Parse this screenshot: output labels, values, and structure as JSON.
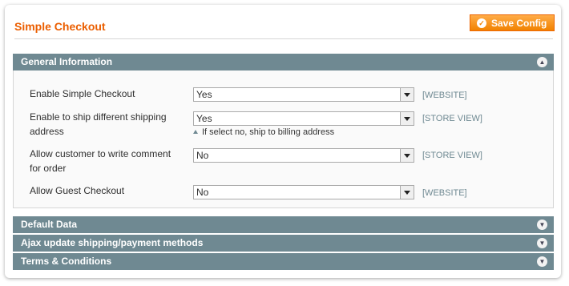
{
  "page": {
    "title": "Simple Checkout",
    "save_label": "Save Config"
  },
  "sections": [
    {
      "label": "General Information",
      "state": "expanded"
    },
    {
      "label": "Default Data",
      "state": "collapsed"
    },
    {
      "label": "Ajax update shipping/payment methods",
      "state": "collapsed"
    },
    {
      "label": "Terms & Conditions",
      "state": "collapsed"
    }
  ],
  "general": {
    "rows": [
      {
        "label": "Enable Simple Checkout",
        "value": "Yes",
        "scope": "[WEBSITE]"
      },
      {
        "label": "Enable to ship different shipping address",
        "value": "Yes",
        "scope": "[STORE VIEW]",
        "note": "If select no, ship to billing address"
      },
      {
        "label": "Allow customer to write comment for order",
        "value": "No",
        "scope": "[STORE VIEW]"
      },
      {
        "label": "Allow Guest Checkout",
        "value": "No",
        "scope": "[WEBSITE]"
      }
    ]
  },
  "colors": {
    "title": "#eb5e00",
    "button": "#f18200",
    "section_header": "#6f8992"
  }
}
